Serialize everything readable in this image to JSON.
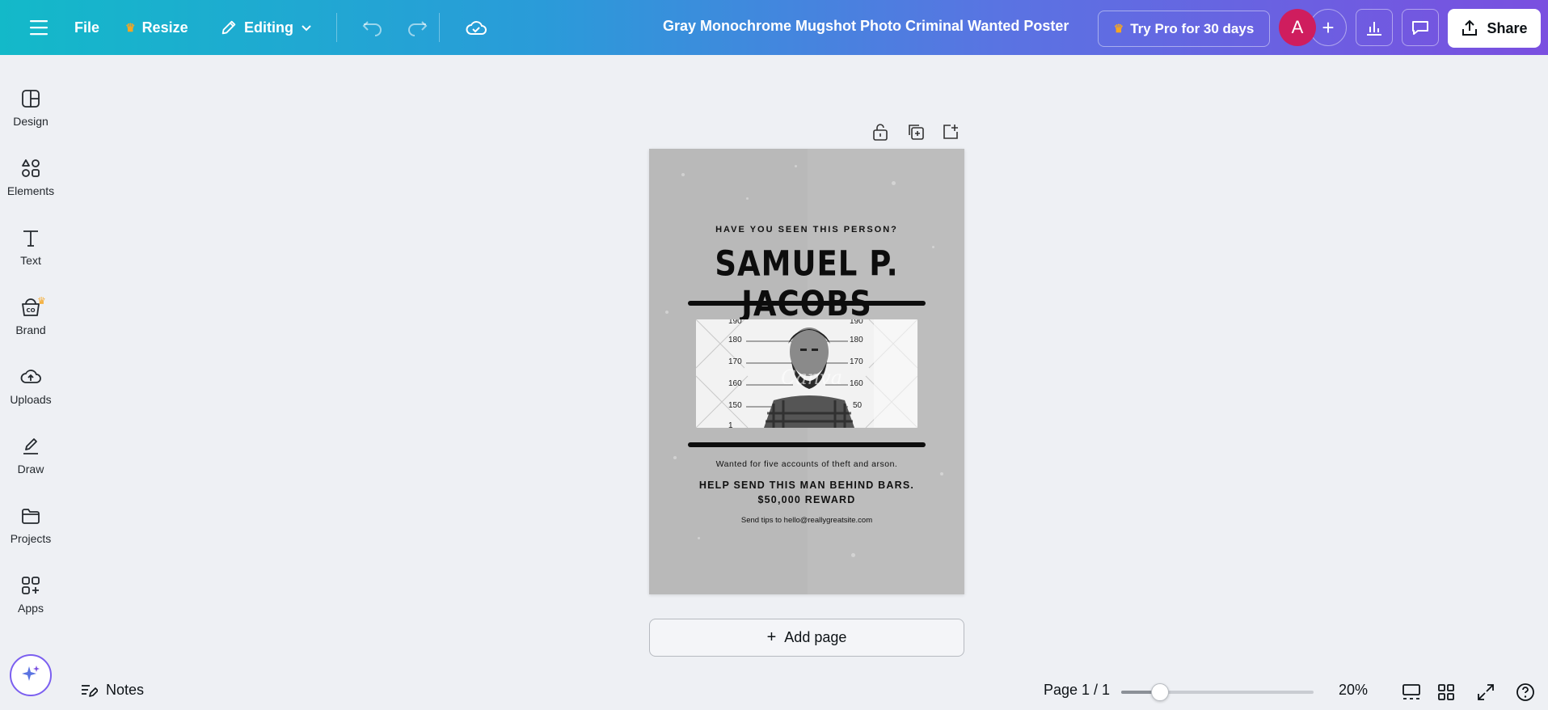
{
  "topbar": {
    "file_label": "File",
    "resize_label": "Resize",
    "editing_label": "Editing",
    "document_title": "Gray Monochrome Mugshot Photo Criminal Wanted Poster",
    "pro_label": "Try Pro for 30 days",
    "avatar_initial": "A",
    "share_label": "Share"
  },
  "sidebar": {
    "items": [
      {
        "label": "Design",
        "icon": "design-icon"
      },
      {
        "label": "Elements",
        "icon": "elements-icon"
      },
      {
        "label": "Text",
        "icon": "text-icon"
      },
      {
        "label": "Brand",
        "icon": "brand-icon"
      },
      {
        "label": "Uploads",
        "icon": "uploads-icon"
      },
      {
        "label": "Draw",
        "icon": "draw-icon"
      },
      {
        "label": "Projects",
        "icon": "projects-icon"
      },
      {
        "label": "Apps",
        "icon": "apps-icon"
      }
    ]
  },
  "poster": {
    "kicker": "HAVE YOU SEEN THIS PERSON?",
    "name": "SAMUEL P. JACOBS",
    "height_marks_left": [
      "190",
      "180",
      "170",
      "160",
      "150",
      "1"
    ],
    "height_marks_right": [
      "190",
      "180",
      "170",
      "160",
      "50"
    ],
    "watermark": "Canva",
    "line1": "Wanted for five accounts of theft and arson.",
    "line2": "HELP SEND THIS MAN BEHIND BARS.",
    "line3": "$50,000 REWARD",
    "line4": "Send tips to hello@reallygreatsite.com"
  },
  "canvas": {
    "add_page_label": "Add page"
  },
  "bottombar": {
    "notes_label": "Notes",
    "page_indicator": "Page 1 / 1",
    "zoom_label": "20%",
    "zoom_fraction": 0.2
  },
  "colors": {
    "brand_gradient_start": "#13b9c9",
    "brand_gradient_end": "#7a4fe0",
    "avatar_bg": "#cf1d5e",
    "crown": "#f5a623"
  }
}
